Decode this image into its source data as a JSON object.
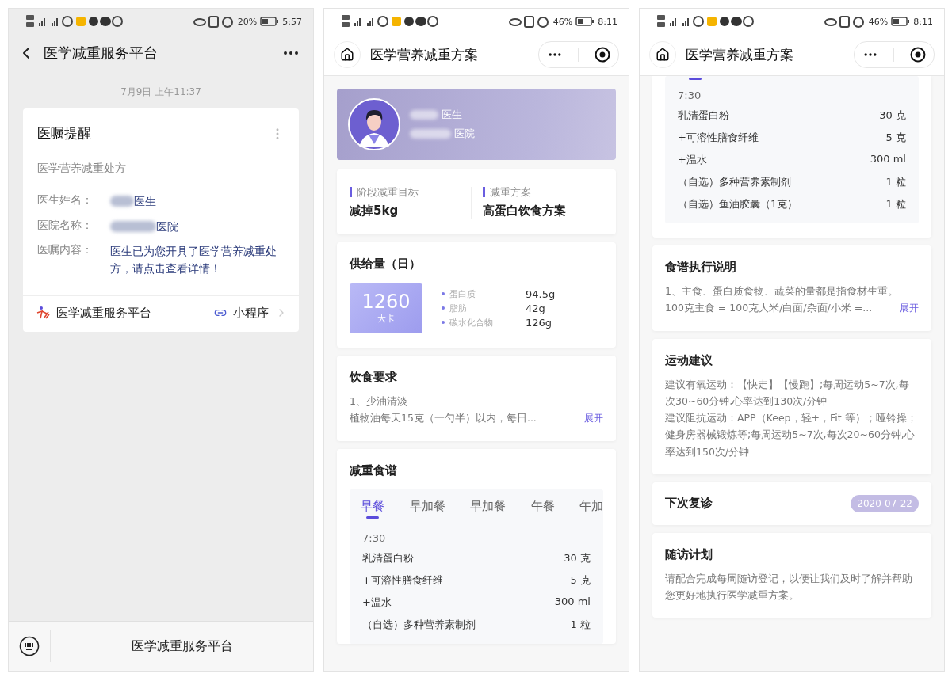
{
  "screens": [
    {
      "kind": "chat",
      "status": {
        "battery": "20%",
        "time": "5:57"
      },
      "nav": {
        "title": "医学减重服务平台"
      },
      "timestamp": "7月9日 上午11:37",
      "card": {
        "title": "医嘱提醒",
        "subtitle": "医学营养减重处方",
        "fields": [
          {
            "label": "医生姓名：",
            "value": "医生",
            "redacted": true
          },
          {
            "label": "医院名称：",
            "value": "医院",
            "redacted": true
          },
          {
            "label": "医嘱内容：",
            "value": "医生已为您开具了医学营养减重处方，请点击查看详情！",
            "redacted": false
          }
        ],
        "source": {
          "name": "医学减重服务平台",
          "tag": "小程序"
        }
      },
      "footer": {
        "title": "医学减重服务平台"
      }
    },
    {
      "kind": "plan",
      "status": {
        "battery": "46%",
        "time": "8:11"
      },
      "title": "医学营养减重方案",
      "sections": [
        {
          "kind": "profile",
          "doctor": "医生",
          "hospital": "医院"
        },
        {
          "kind": "goals",
          "items": [
            {
              "label": "阶段减重目标",
              "value": "减掉5kg"
            },
            {
              "label": "减重方案",
              "value": "高蛋白饮食方案"
            }
          ]
        },
        {
          "kind": "supply",
          "title": "供给量（日）",
          "calories": "1260",
          "unit": "大卡",
          "nutrients": [
            {
              "name": "蛋白质",
              "amount": "94.5g"
            },
            {
              "name": "脂肪",
              "amount": "42g"
            },
            {
              "name": "碳水化合物",
              "amount": "126g"
            }
          ]
        },
        {
          "kind": "text",
          "title": "饮食要求",
          "lines": [
            "1、少油清淡",
            "植物油每天15克（一勺半）以内，每日..."
          ],
          "more": "展开"
        },
        {
          "kind": "recipe",
          "title": "减重食谱",
          "tabs": [
            {
              "label": "早餐",
              "selected": true
            },
            {
              "label": "早加餐",
              "selected": false
            },
            {
              "label": "早加餐",
              "selected": false
            },
            {
              "label": "午餐",
              "selected": false
            },
            {
              "label": "午加",
              "selected": false
            }
          ],
          "time": "7:30",
          "items": [
            {
              "name": "乳清蛋白粉",
              "amount": "30 克"
            },
            {
              "name": "+可溶性膳食纤维",
              "amount": "5 克"
            },
            {
              "name": "+温水",
              "amount": "300 ml"
            },
            {
              "name": "（自选）多种营养素制剂",
              "amount": "1 粒"
            }
          ]
        }
      ]
    },
    {
      "kind": "plan",
      "status": {
        "battery": "46%",
        "time": "8:11"
      },
      "title": "医学营养减重方案",
      "sections": [
        {
          "kind": "recipe_tail",
          "time": "7:30",
          "items": [
            {
              "name": "乳清蛋白粉",
              "amount": "30 克"
            },
            {
              "name": "+可溶性膳食纤维",
              "amount": "5 克"
            },
            {
              "name": "+温水",
              "amount": "300 ml"
            },
            {
              "name": "（自选）多种营养素制剂",
              "amount": "1 粒"
            },
            {
              "name": "（自选）鱼油胶囊（1克）",
              "amount": "1 粒"
            }
          ]
        },
        {
          "kind": "text",
          "title": "食谱执行说明",
          "lines": [
            "1、主食、蛋白质食物、蔬菜的量都是指食材生重。",
            "100克主食 = 100克大米/白面/杂面/小米 =..."
          ],
          "more": "展开"
        },
        {
          "kind": "text",
          "title": "运动建议",
          "lines": [
            "建议有氧运动：【快走】【慢跑】;每周运动5~7次,每次30~60分钟,心率达到130次/分钟",
            "建议阻抗运动：APP（Keep，轻+，Fit 等）；哑铃操；健身房器械锻炼等;每周运动5~7次,每次20~60分钟,心率达到150次/分钟"
          ]
        },
        {
          "kind": "date",
          "title": "下次复诊",
          "date": "2020-07-22"
        },
        {
          "kind": "text",
          "title": "随访计划",
          "lines": [
            "请配合完成每周随访登记，以便让我们及时了解并帮助您更好地执行医学减重方案。"
          ]
        }
      ]
    }
  ]
}
